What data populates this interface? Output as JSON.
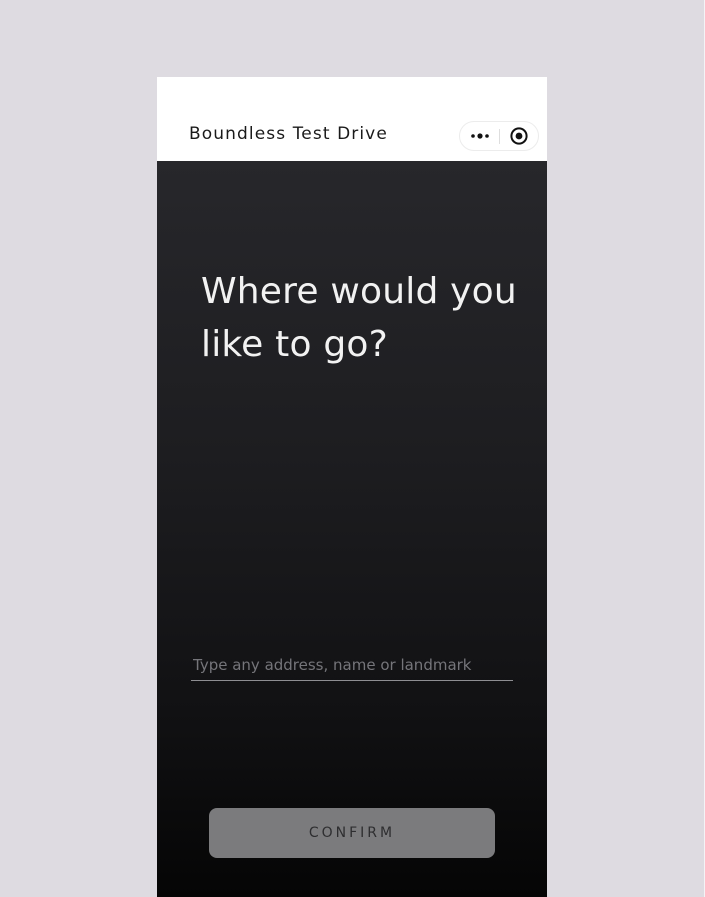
{
  "app": {
    "title": "Boundless Test Drive"
  },
  "capsule": {
    "more_icon": "more-dots-icon",
    "close_icon": "target-close-icon"
  },
  "main": {
    "headline": "Where would you like to go?",
    "address_input": {
      "value": "",
      "placeholder": "Type any address, name or landmark"
    },
    "confirm_label": "CONFIRM"
  },
  "colors": {
    "page_background": "#dedbe1",
    "topbar_background": "#ffffff",
    "content_top": "#27272b",
    "content_bottom": "#050505",
    "headline_text": "#f2f2f2",
    "confirm_background": "#7b7b7d",
    "confirm_text": "#2e2e30"
  }
}
